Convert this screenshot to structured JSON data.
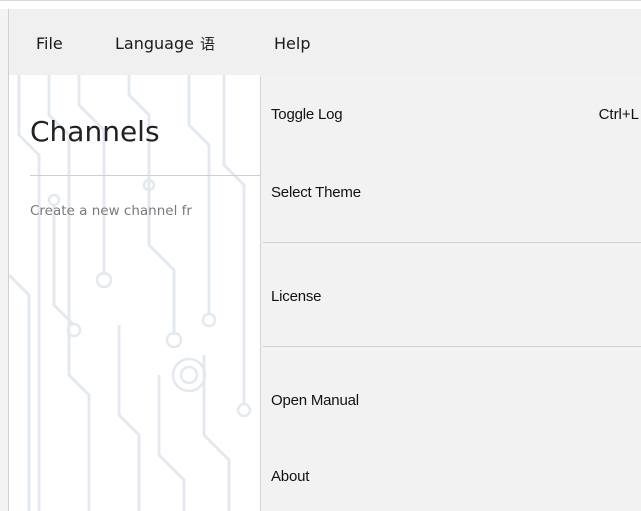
{
  "menubar": {
    "file_label": "File",
    "language_label": "Language",
    "language_icon_glyph": "语",
    "help_label": "Help"
  },
  "main": {
    "title": "Channels",
    "subtext": "Create a new channel fr"
  },
  "help_menu": {
    "toggle_log_label": "Toggle Log",
    "toggle_log_shortcut": "Ctrl+L",
    "select_theme_label": "Select Theme",
    "license_label": "License",
    "open_manual_label": "Open Manual",
    "about_label": "About"
  },
  "colors": {
    "menubar_bg": "#f0f0f0",
    "dropdown_bg": "#f2f2f2",
    "panel_bg": "#ffffff",
    "circuit_lines": "#e4e9f0"
  },
  "icons": {
    "language": "language-icon",
    "background": "circuit-background"
  }
}
